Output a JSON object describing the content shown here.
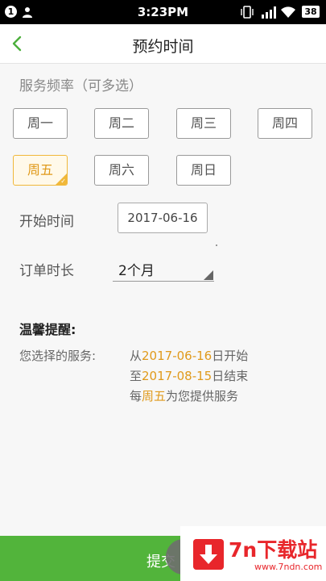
{
  "status_bar": {
    "notification_count": "1",
    "time": "3:23PM",
    "battery": "38"
  },
  "header": {
    "title": "预约时间",
    "back_icon": "chevron-left-icon"
  },
  "frequency": {
    "label": "服务频率（可多选）",
    "days": [
      {
        "label": "周一",
        "selected": false
      },
      {
        "label": "周二",
        "selected": false
      },
      {
        "label": "周三",
        "selected": false
      },
      {
        "label": "周四",
        "selected": false
      },
      {
        "label": "周五",
        "selected": true
      },
      {
        "label": "周六",
        "selected": false
      },
      {
        "label": "周日",
        "selected": false
      }
    ]
  },
  "start_time": {
    "label": "开始时间",
    "value": "2017-06-16"
  },
  "duration": {
    "label": "订单时长",
    "value": "2个月"
  },
  "tips": {
    "title": "温馨提醒:",
    "label": "您选择的服务:",
    "line1_prefix": "从",
    "line1_date": "2017-06-16",
    "line1_suffix": "日开始",
    "line2_prefix": "至",
    "line2_date": "2017-08-15",
    "line2_suffix": "日结束",
    "line3_prefix": "每",
    "line3_day": "周五",
    "line3_suffix": "为您提供服务"
  },
  "submit": {
    "label": "提交"
  },
  "watermark": {
    "title": "7n下载站",
    "url": "www.7ndn.com"
  },
  "colors": {
    "accent_green": "#52b43b",
    "highlight_orange": "#e09a1c",
    "selected_border": "#f0b83a"
  }
}
